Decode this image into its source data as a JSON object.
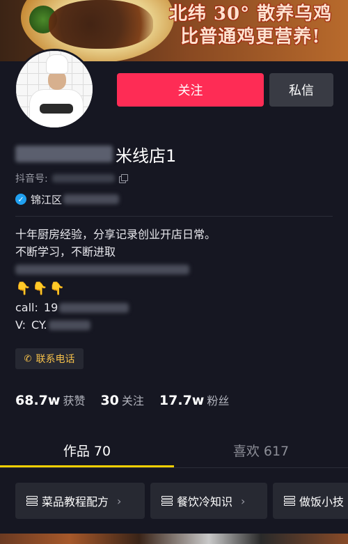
{
  "banner": {
    "line1": "北纬 30° 散养乌鸡",
    "line2": "比普通鸡更营养!"
  },
  "header": {
    "follow_label": "关注",
    "message_label": "私信"
  },
  "profile": {
    "name_suffix": "米线店1",
    "id_label": "抖音号:",
    "location_prefix": "锦江区",
    "verified_icon": "verified-check-icon"
  },
  "bio": {
    "line1": "十年厨房经验，分享记录创业开店日常。",
    "line2": "不断学习，不断进取",
    "hands": "👇👇👇",
    "call_label": "call:",
    "call_visible": "19",
    "v_label": "V:",
    "v_visible": "CY."
  },
  "contact": {
    "label": "联系电话",
    "icon": "phone-icon"
  },
  "stats": [
    {
      "value": "68.7w",
      "label": "获赞"
    },
    {
      "value": "30",
      "label": "关注"
    },
    {
      "value": "17.7w",
      "label": "粉丝"
    }
  ],
  "tabs": [
    {
      "label": "作品 70",
      "active": true
    },
    {
      "label": "喜欢 617",
      "active": false
    }
  ],
  "collections": [
    {
      "label": "菜品教程配方",
      "icon": "stack-icon"
    },
    {
      "label": "餐饮冷知识",
      "icon": "stack-icon"
    },
    {
      "label": "做饭小技",
      "icon": "stack-icon"
    }
  ],
  "colors": {
    "background": "#161722",
    "follow": "#fe2c55",
    "tab_indicator": "#f3d000",
    "contact_text": "#f5c04a"
  }
}
